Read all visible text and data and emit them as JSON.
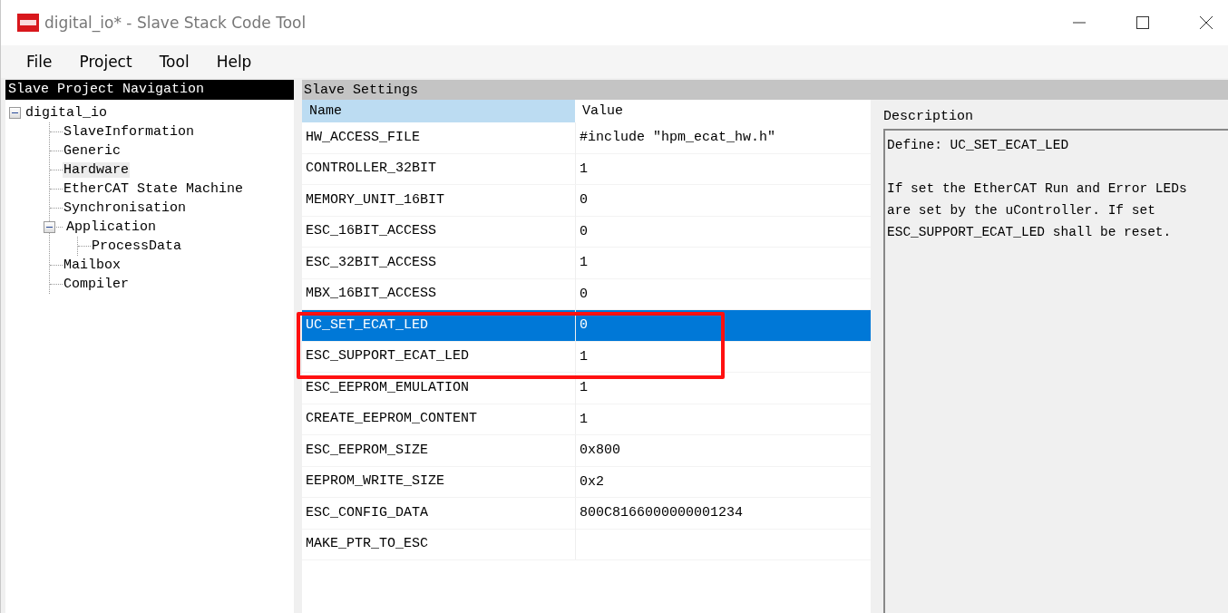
{
  "window": {
    "title": "digital_io* - Slave Stack Code Tool"
  },
  "menu": [
    "File",
    "Project",
    "Tool",
    "Help"
  ],
  "navigation": {
    "title": "Slave Project Navigation",
    "tree": [
      {
        "label": "digital_io",
        "expanded": true,
        "selected": false,
        "children": [
          {
            "label": "SlaveInformation",
            "selected": false
          },
          {
            "label": "Generic",
            "selected": false
          },
          {
            "label": "Hardware",
            "selected": true
          },
          {
            "label": "EtherCAT State Machine",
            "selected": false
          },
          {
            "label": "Synchronisation",
            "selected": false
          },
          {
            "label": "Application",
            "expanded": true,
            "selected": false,
            "children": [
              {
                "label": "ProcessData",
                "selected": false
              }
            ]
          },
          {
            "label": "Mailbox",
            "selected": false
          },
          {
            "label": "Compiler",
            "selected": false
          }
        ]
      }
    ]
  },
  "settings": {
    "title": "Slave Settings",
    "columns": [
      "Name",
      "Value"
    ],
    "rows": [
      {
        "name": "HW_ACCESS_FILE",
        "value": "#include \"hpm_ecat_hw.h\"",
        "selected": false
      },
      {
        "name": "CONTROLLER_32BIT",
        "value": "1",
        "selected": false
      },
      {
        "name": "MEMORY_UNIT_16BIT",
        "value": "0",
        "selected": false
      },
      {
        "name": "ESC_16BIT_ACCESS",
        "value": "0",
        "selected": false
      },
      {
        "name": "ESC_32BIT_ACCESS",
        "value": "1",
        "selected": false
      },
      {
        "name": "MBX_16BIT_ACCESS",
        "value": "0",
        "selected": false
      },
      {
        "name": "UC_SET_ECAT_LED",
        "value": "0",
        "selected": true
      },
      {
        "name": "ESC_SUPPORT_ECAT_LED",
        "value": "1",
        "selected": false
      },
      {
        "name": "ESC_EEPROM_EMULATION",
        "value": "1",
        "selected": false
      },
      {
        "name": "CREATE_EEPROM_CONTENT",
        "value": "1",
        "selected": false
      },
      {
        "name": "ESC_EEPROM_SIZE",
        "value": "0x800",
        "selected": false
      },
      {
        "name": "EEPROM_WRITE_SIZE",
        "value": "0x2",
        "selected": false
      },
      {
        "name": "ESC_CONFIG_DATA",
        "value": "800C8166000000001234",
        "selected": false
      },
      {
        "name": "MAKE_PTR_TO_ESC",
        "value": "",
        "selected": false
      }
    ]
  },
  "description": {
    "title": "Description",
    "definition": "Define: UC_SET_ECAT_LED",
    "text": "If set the EtherCAT Run and Error LEDs\nare set by the uController. If set\nESC_SUPPORT_ECAT_LED shall be reset."
  }
}
